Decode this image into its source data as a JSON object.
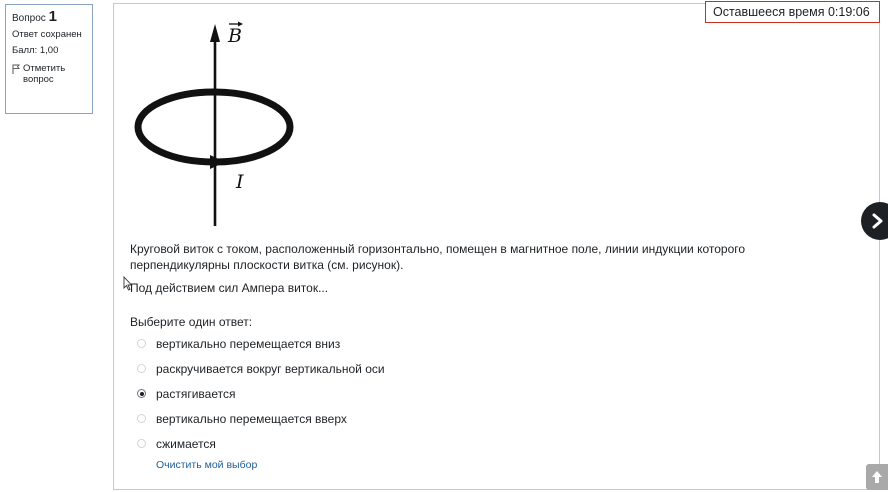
{
  "info": {
    "question_label": "Вопрос",
    "question_number": "1",
    "state": "Ответ сохранен",
    "grade": "Балл: 1,00",
    "flag_label": "Отметить вопрос"
  },
  "timer": {
    "text": "Оставшееся время 0:19:06"
  },
  "figure": {
    "vector_label": "B",
    "current_label": "I"
  },
  "question": {
    "text": "Круговой виток с током, расположенный горизонтально, помещен в магнитное поле, линии индукции которого перпендикулярны плоскости витка (см. рисунок).",
    "text2": "Под действием сил Ампера виток..."
  },
  "prompt": "Выберите один ответ:",
  "options": [
    {
      "label": "вертикально перемещается вниз",
      "checked": false
    },
    {
      "label": "раскручивается вокруг вертикальной оси",
      "checked": false
    },
    {
      "label": "растягивается",
      "checked": true
    },
    {
      "label": "вертикально перемещается вверх",
      "checked": false
    },
    {
      "label": "сжимается",
      "checked": false
    }
  ],
  "clear_label": "Очистить мой выбор",
  "colors": {
    "timer_border": "#ca3120",
    "link": "#1f5e95",
    "nav_button": "#1d2125"
  }
}
